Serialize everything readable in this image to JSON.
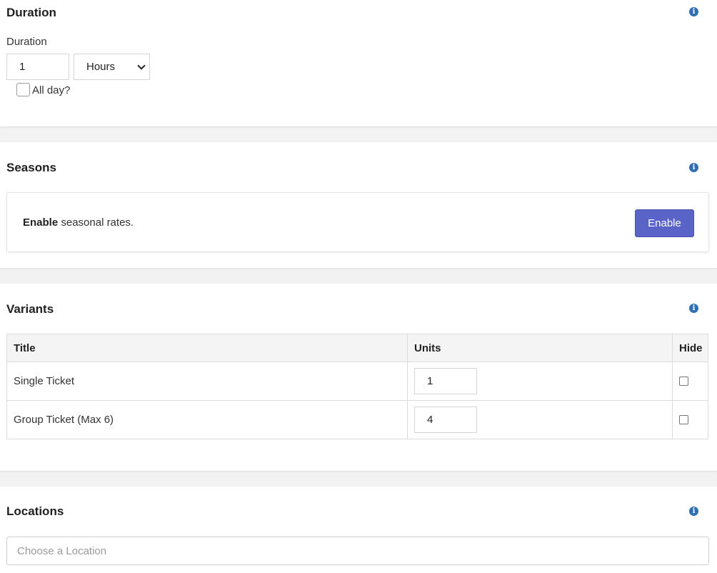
{
  "duration": {
    "title": "Duration",
    "field_label": "Duration",
    "value": "1",
    "unit_selected": "Hours",
    "all_day_label": "All day?",
    "all_day_checked": false
  },
  "seasons": {
    "title": "Seasons",
    "message_strong": "Enable",
    "message_rest": " seasonal rates.",
    "button_label": "Enable"
  },
  "variants": {
    "title": "Variants",
    "columns": [
      "Title",
      "Units",
      "Hide"
    ],
    "rows": [
      {
        "title": "Single Ticket",
        "units": "1",
        "hide": false
      },
      {
        "title": "Group Ticket (Max 6)",
        "units": "4",
        "hide": false
      }
    ]
  },
  "locations": {
    "title": "Locations",
    "placeholder": "Choose a Location"
  },
  "icons": {
    "info": "info-icon"
  },
  "colors": {
    "accent_button": "#5a63c7",
    "info_icon": "#2f6fb3"
  }
}
